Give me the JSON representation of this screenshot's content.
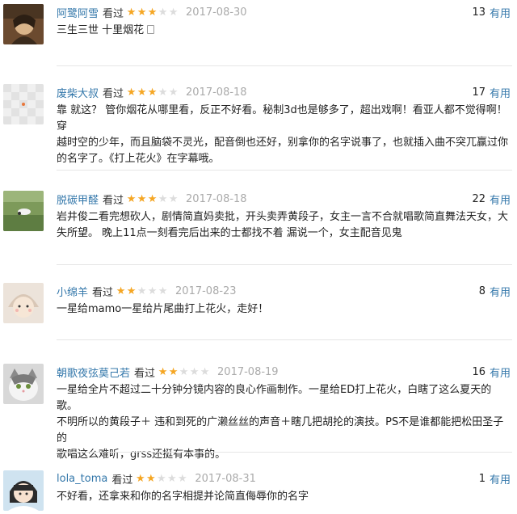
{
  "reviews": [
    {
      "author": "阿鹭阿雪",
      "watched": "看过",
      "rating": 3,
      "date": "2017-08-30",
      "votes": "13",
      "useful": "有用",
      "lines": [
        "三生三世 十里烟花"
      ]
    },
    {
      "author": "废柴大叔",
      "watched": "看过",
      "rating": 3,
      "date": "2017-08-18",
      "votes": "17",
      "useful": "有用",
      "lines": [
        "靠 就这？ 管你烟花从哪里看，反正不好看。秘制3d也是够多了，超出戏啊！看亚人都不觉得啊！穿",
        "越时空的少年，而且脑袋不灵光，配音倒也还好，别拿你的名字说事了，也就插入曲不突兀赢过你",
        "的名字了。《打上花火》在字幕哦。"
      ]
    },
    {
      "author": "脱碳甲醛",
      "watched": "看过",
      "rating": 3,
      "date": "2017-08-18",
      "votes": "22",
      "useful": "有用",
      "lines": [
        "岩井俊二看完想砍人，剧情简直妈卖批，开头卖弄黄段子，女主一言不合就唱歌简直舞法天女，大",
        "失所望。 晚上11点一刻看完后出来的士都找不着 漏说一个，女主配音见鬼"
      ]
    },
    {
      "author": "小绵羊",
      "watched": "看过",
      "rating": 2,
      "date": "2017-08-23",
      "votes": "8",
      "useful": "有用",
      "lines": [
        "一星给mamo一星给片尾曲打上花火，走好！"
      ]
    },
    {
      "author": "朝歌夜弦莫己若",
      "watched": "看过",
      "rating": 2,
      "date": "2017-08-19",
      "votes": "16",
      "useful": "有用",
      "lines": [
        "一星给全片不超过二十分钟分镜内容的良心作画制作。一星给ED打上花火，白瞎了这么夏天的歌。",
        "不明所以的黄段子＋ 违和到死的广濑丝丝的声音＋瞎几把胡抡的演技。PS不是谁都能把松田圣子的",
        "歌唱这么难听，grss还挺有本事的。"
      ]
    },
    {
      "author": "lola_toma",
      "watched": "看过",
      "rating": 2,
      "date": "2017-08-31",
      "votes": "1",
      "useful": "有用",
      "lines": [
        "不好看，还拿来和你的名字相提并论简直侮辱你的名字"
      ]
    }
  ]
}
